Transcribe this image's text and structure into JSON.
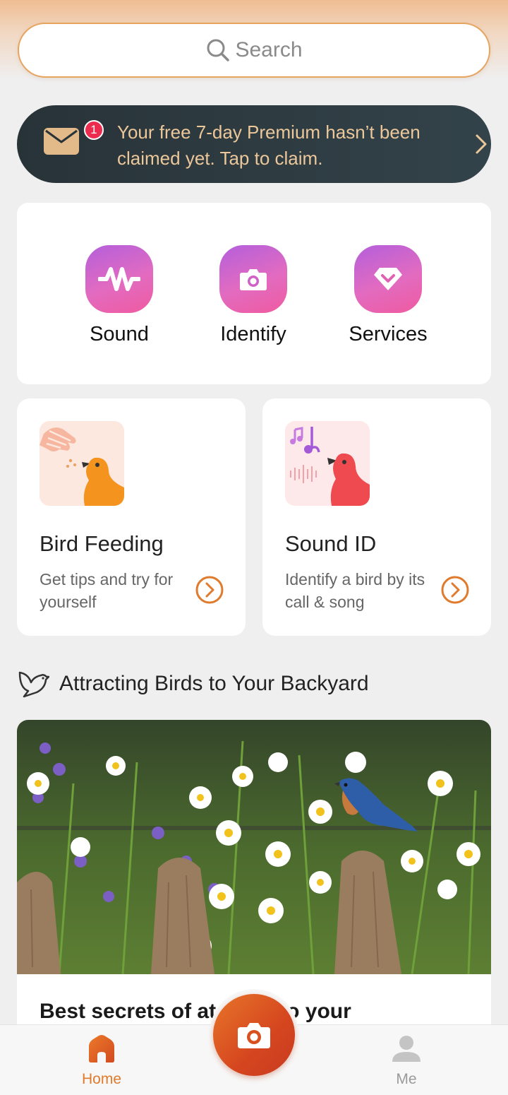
{
  "search": {
    "placeholder": "Search"
  },
  "promo": {
    "badge_count": "1",
    "message": "Your free 7-day Premium hasn’t been claimed yet. Tap to claim."
  },
  "quick_actions": [
    {
      "label": "Sound",
      "icon": "sound-wave-icon"
    },
    {
      "label": "Identify",
      "icon": "camera-icon"
    },
    {
      "label": "Services",
      "icon": "diamond-icon"
    }
  ],
  "features": [
    {
      "title": "Bird Feeding",
      "description": "Get tips and try for yourself",
      "icon": "bird-feeding-icon"
    },
    {
      "title": "Sound ID",
      "description": "Identify a bird by its call & song",
      "icon": "sound-id-icon"
    }
  ],
  "section": {
    "title": "Attracting Birds to Your Backyard",
    "icon": "bird-outline-icon"
  },
  "article": {
    "title": "Best secrets of at   birds to your"
  },
  "tabbar": {
    "home_label": "Home",
    "me_label": "Me",
    "active": "Home"
  },
  "colors": {
    "accent": "#e07a2c",
    "promo_bg": "#283338",
    "promo_text": "#ecc79a",
    "badge": "#ec2c4f",
    "icon_gradient_start": "#b45fdc",
    "icon_gradient_end": "#ef5aa0"
  }
}
